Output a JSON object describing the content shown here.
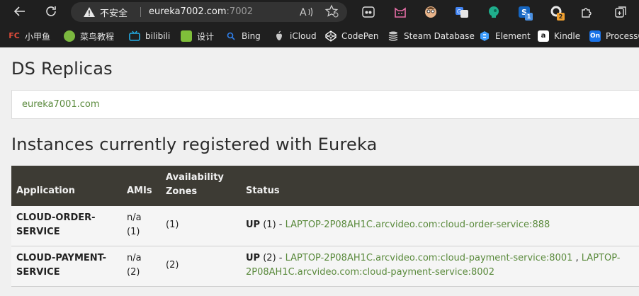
{
  "browser": {
    "insecure_label": "不安全",
    "host": "eureka7002.com",
    "port": ":7002",
    "extension_badges": [
      "1",
      "2"
    ]
  },
  "bookmarks": [
    {
      "label": "小甲鱼",
      "icon": "FC",
      "color": "#c0392b"
    },
    {
      "label": "菜鸟教程",
      "icon": "runoob-icon",
      "color": "#7bb83f"
    },
    {
      "label": "bilibili",
      "icon": "bilibili-icon",
      "color": "#23ade5"
    },
    {
      "label": "设计",
      "icon": "design-icon",
      "color": "#7fbf3a"
    },
    {
      "label": "Bing",
      "icon": "search-icon",
      "color": "#2f80ed"
    },
    {
      "label": "iCloud",
      "icon": "apple-icon",
      "color": "#c8c8c8"
    },
    {
      "label": "CodePen",
      "icon": "codepen-icon",
      "color": "#ffffff"
    },
    {
      "label": "Steam Database",
      "icon": "database-icon",
      "color": "#c8c8c8"
    },
    {
      "label": "Element",
      "icon": "element-icon",
      "color": "#409eff"
    },
    {
      "label": "Kindle",
      "icon": "a",
      "color": "#ffffff"
    },
    {
      "label": "ProcessOn",
      "icon": "On",
      "color": "#1a73e8"
    }
  ],
  "page": {
    "ds_title": "DS Replicas",
    "replica_link": "eureka7001.com",
    "instances_title": "Instances currently registered with Eureka"
  },
  "table": {
    "headers": {
      "application": "Application",
      "amis": "AMIs",
      "zones": "Availability Zones",
      "status": "Status"
    },
    "rows": [
      {
        "application": "CLOUD-ORDER-SERVICE",
        "amis_value": "n/a",
        "amis_count": "(1)",
        "zones": "(1)",
        "status_state": "UP",
        "status_count": " (1) - ",
        "links": [
          "LAPTOP-2P08AH1C.arcvideo.com:cloud-order-service:888"
        ]
      },
      {
        "application": "CLOUD-PAYMENT-SERVICE",
        "amis_value": "n/a",
        "amis_count": "(2)",
        "zones": "(2)",
        "status_state": "UP",
        "status_count": " (2) - ",
        "links": [
          "LAPTOP-2P08AH1C.arcvideo.com:cloud-payment-service:8001",
          "LAPTOP-2P08AH1C.arcvideo.com:cloud-payment-service:8002"
        ],
        "link_separator": " , "
      }
    ]
  },
  "colors": {
    "link": "#5a8a3c",
    "table_header_bg": "#3d3b34",
    "browser_chrome": "#1f1f1f"
  }
}
